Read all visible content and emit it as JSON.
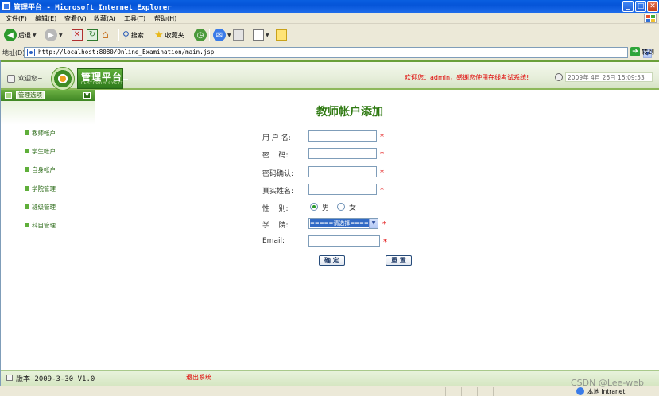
{
  "window": {
    "title": "管理平台 - Microsoft Internet Explorer",
    "min": "_",
    "max": "□",
    "close": "✕"
  },
  "menu": [
    "文件(F)",
    "编辑(E)",
    "查看(V)",
    "收藏(A)",
    "工具(T)",
    "帮助(H)"
  ],
  "toolbar": {
    "back": "后退",
    "search": "搜索",
    "favorites": "收藏夹"
  },
  "address": {
    "label": "地址(D)",
    "url": "http://localhost:8080/Online_Examination/main.jsp",
    "go": "转到"
  },
  "header": {
    "welcome": "欢迎您~",
    "logo_title": "管理平台",
    "logo_sub": "PLATFORM SYSYTEM",
    "message": "欢迎您：admin，感谢您使用在线考试系统!",
    "date": "2009年 4月 26日 15:09:53"
  },
  "sidebar": {
    "title": "管理选项",
    "items": [
      {
        "label": "教师帐户"
      },
      {
        "label": "学生帐户"
      },
      {
        "label": "自身帐户"
      },
      {
        "label": "学院管理"
      },
      {
        "label": "班级管理"
      },
      {
        "label": "科目管理"
      }
    ]
  },
  "form": {
    "title": "教师帐户添加",
    "username_label": "用 户 名:",
    "password_label": "密    码:",
    "confirm_label": "密码确认:",
    "realname_label": "真实姓名:",
    "gender_label": "性    别:",
    "gender_male": "男",
    "gender_female": "女",
    "college_label": "学    院:",
    "college_value": "=====请选择=====",
    "email_label": "Email:",
    "required_mark": "*",
    "submit": "确  定",
    "reset": "重  置"
  },
  "footer": {
    "version": "版本 2009-3-30 V1.0",
    "logout": "退出系统"
  },
  "status": {
    "zone": "本地 Intranet"
  },
  "watermark": "CSDN @Lee-web"
}
